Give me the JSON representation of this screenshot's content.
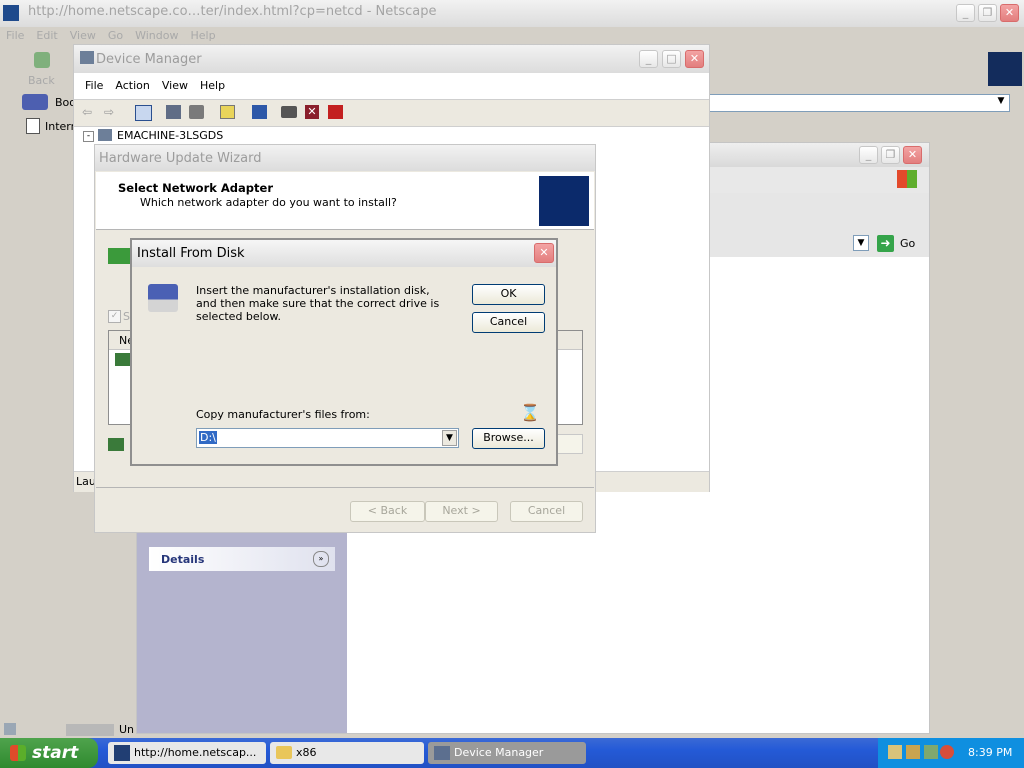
{
  "netscape": {
    "title": "http://home.netscape.co…ter/index.html?cp=netcd - Netscape",
    "menu": [
      "File",
      "Edit",
      "View",
      "Go",
      "Window",
      "Help"
    ],
    "back_label": "Back",
    "toolbar_rows": [
      "Boo",
      "Intern"
    ],
    "status_left": "Un"
  },
  "device_manager": {
    "title": "Device Manager",
    "menu": [
      "File",
      "Action",
      "View",
      "Help"
    ],
    "tree_root": "EMACHINE-3LSGDS",
    "status": "Lau"
  },
  "hardware_wizard": {
    "title": "Hardware Update Wizard",
    "header_title": "Select Network Adapter",
    "header_subtitle": "Which network adapter do you want to install?",
    "hidden_checkbox_label": "S",
    "list_header": "Ne",
    "buttons": {
      "back": "< Back",
      "next": "Next >",
      "cancel": "Cancel"
    }
  },
  "background_window": {
    "go_label": "Go",
    "details_label": "Details"
  },
  "install_from_disk": {
    "title": "Install From Disk",
    "message": "Insert the manufacturer's installation disk, and then make sure that the correct drive is selected below.",
    "ok": "OK",
    "cancel": "Cancel",
    "copy_label": "Copy manufacturer's files from:",
    "path_value": "D:\\",
    "browse": "Browse..."
  },
  "taskbar": {
    "start": "start",
    "tasks": [
      "http://home.netscap...",
      "x86",
      "Device Manager"
    ],
    "clock": "8:39 PM"
  }
}
